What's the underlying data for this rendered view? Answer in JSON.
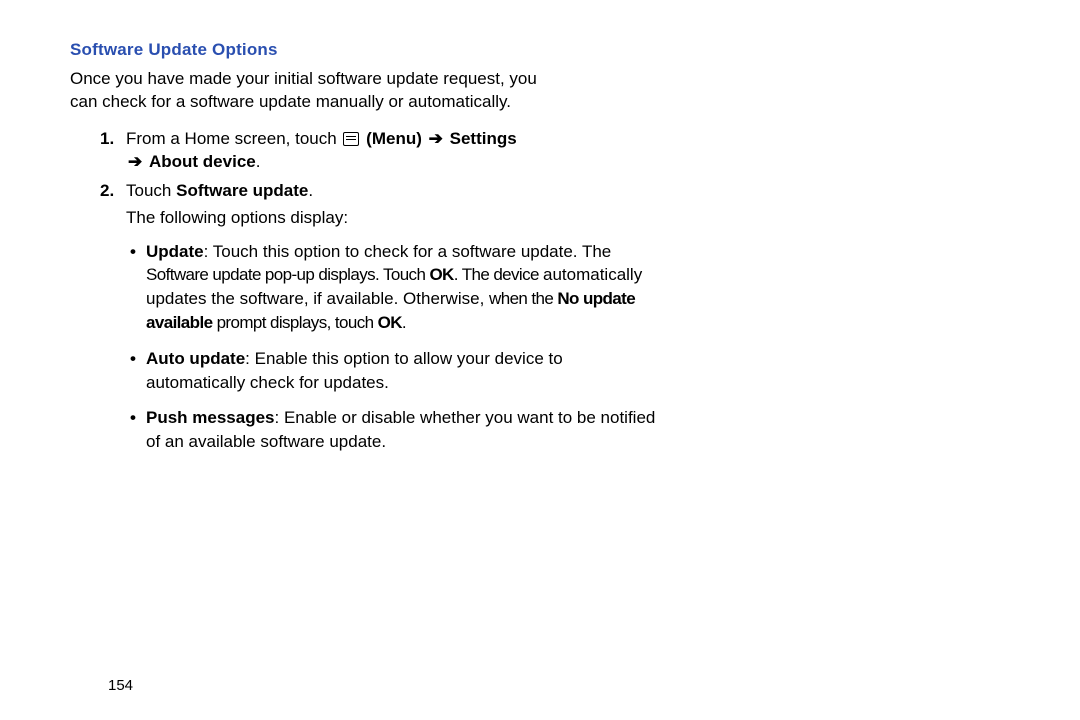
{
  "heading": "Software Update Options",
  "intro": "Once you have made your initial software update request, you can check for a software update manually or automatically.",
  "step1": {
    "num": "1.",
    "pre": "From a Home screen, touch",
    "menu_label": "(Menu)",
    "settings": "Settings",
    "about": "About device",
    "dot": "."
  },
  "step2": {
    "num": "2.",
    "pre": "Touch",
    "sw": "Software update",
    "dot": ".",
    "follow": "The following options display:"
  },
  "arrow": "➔",
  "bullets": {
    "update": {
      "title": "Update",
      "l1a": ": Touch this option to check for a software update. The",
      "l2": "Software update pop-up displays. Touch",
      "ok1": "OK",
      "l2b": "The device",
      "l3": "automatically updates the software, if available. Otherwise,",
      "l4a": "when the",
      "nua": "No update available",
      "l4b": " prompt displays, touch",
      "ok2": "OK"
    },
    "auto": {
      "title": "Auto update",
      "rest": ": Enable this option to allow your device to automatically check for updates."
    },
    "push": {
      "title": "Push messages",
      "rest": ": Enable or disable whether you want to be notified of an available software update."
    }
  },
  "page_number": "154"
}
